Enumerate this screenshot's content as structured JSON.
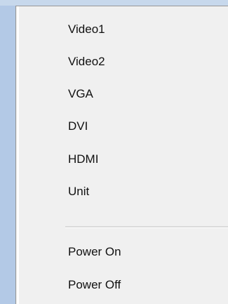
{
  "menu": {
    "items": [
      {
        "label": "Video1"
      },
      {
        "label": "Video2"
      },
      {
        "label": "VGA"
      },
      {
        "label": "DVI"
      },
      {
        "label": "HDMI"
      },
      {
        "label": "Unit"
      }
    ],
    "power_items": [
      {
        "label": "Power On"
      },
      {
        "label": "Power Off"
      }
    ]
  }
}
